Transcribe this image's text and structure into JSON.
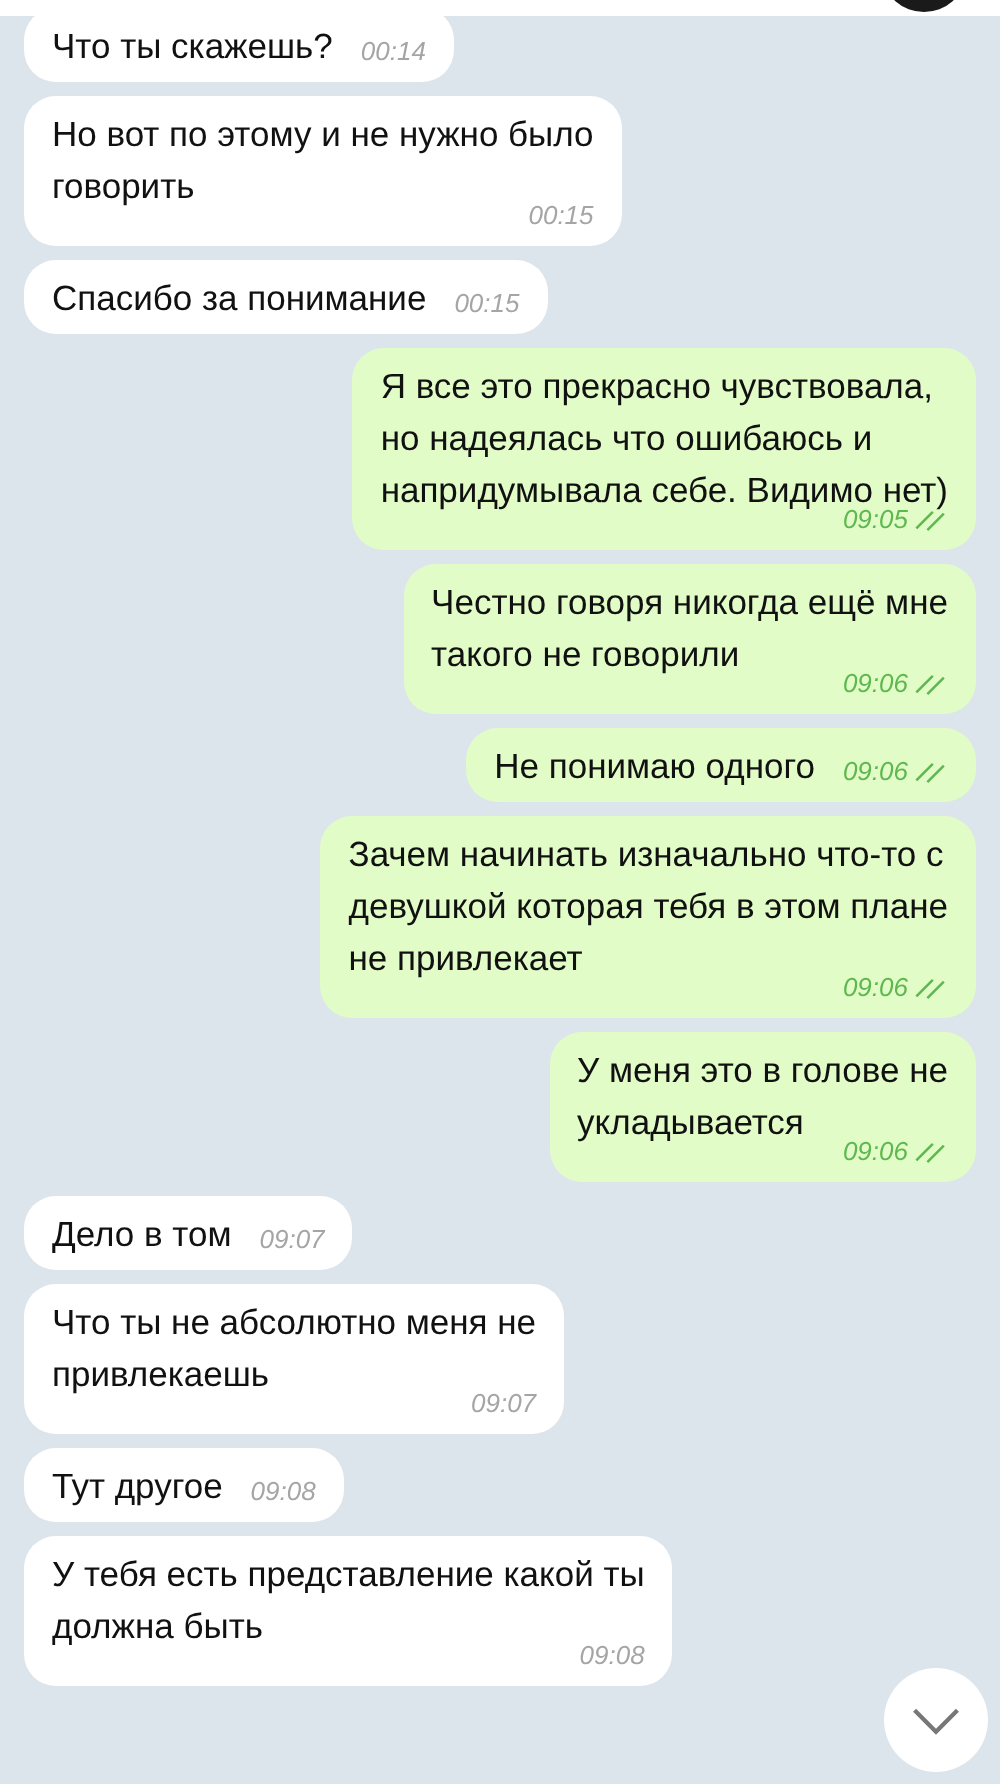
{
  "messages": [
    {
      "text": "Что ты скажешь?",
      "time": "00:14",
      "outgoing": false
    },
    {
      "text": "Но вот по этому и не нужно было\nговорить",
      "time": "00:15",
      "outgoing": false
    },
    {
      "text": "Спасибо за понимание",
      "time": "00:15",
      "outgoing": false
    },
    {
      "text": "Я все это прекрасно чувствовала,\nно надеялась что ошибаюсь и\nнапридумывала себе. Видимо нет)",
      "time": "09:05",
      "outgoing": true,
      "read": true
    },
    {
      "text": "Честно говоря никогда ещё мне\nтакого не говорили",
      "time": "09:06",
      "outgoing": true,
      "read": true
    },
    {
      "text": "Не понимаю одного",
      "time": "09:06",
      "outgoing": true,
      "read": true
    },
    {
      "text": "Зачем начинать изначально что-то с\nдевушкой которая тебя в этом плане\nне привлекает",
      "time": "09:06",
      "outgoing": true,
      "read": true
    },
    {
      "text": "У меня это в голове не\nукладывается",
      "time": "09:06",
      "outgoing": true,
      "read": true
    },
    {
      "text": "Дело в том",
      "time": "09:07",
      "outgoing": false
    },
    {
      "text": "Что ты не абсолютно меня не\nпривлекаешь",
      "time": "09:07",
      "outgoing": false
    },
    {
      "text": "Тут другое",
      "time": "09:08",
      "outgoing": false
    },
    {
      "text": "У тебя есть представление какой ты\nдолжна быть",
      "time": "09:08",
      "outgoing": false
    }
  ]
}
